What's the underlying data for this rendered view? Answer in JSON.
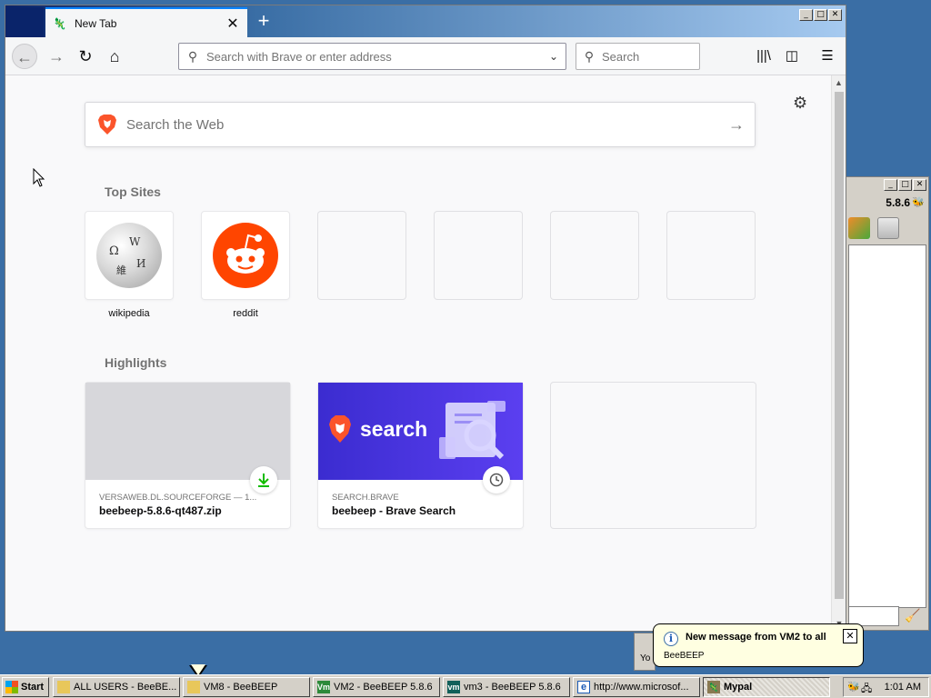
{
  "browser": {
    "tab_title": "New Tab",
    "new_tab_symbol": "+",
    "url_placeholder": "Search with Brave or enter address",
    "search_placeholder": "Search"
  },
  "newtab": {
    "web_search_placeholder": "Search the Web",
    "top_sites_title": "Top Sites",
    "top_sites": [
      {
        "label": "wikipedia",
        "icon": "wikipedia-globe"
      },
      {
        "label": "reddit",
        "icon": "reddit-alien"
      },
      {
        "label": "",
        "icon": ""
      },
      {
        "label": "",
        "icon": ""
      },
      {
        "label": "",
        "icon": ""
      },
      {
        "label": "",
        "icon": ""
      }
    ],
    "highlights_title": "Highlights",
    "highlights": [
      {
        "source": "VERSAWEB.DL.SOURCEFORGE — 1...",
        "title": "beebeep-5.8.6-qt487.zip",
        "badge_icon": "download-icon"
      },
      {
        "source": "SEARCH.BRAVE",
        "title": "beebeep - Brave Search",
        "badge_icon": "clock-icon",
        "thumb_text": "search"
      }
    ]
  },
  "beebeep": {
    "version": "5.8.6"
  },
  "notification": {
    "title": "New message from VM2 to all",
    "body": "BeeBEEP",
    "peek_text": "Yo"
  },
  "taskbar": {
    "start_label": "Start",
    "items": [
      {
        "label": "ALL USERS - BeeBE...",
        "icon": "folder-icon"
      },
      {
        "label": "VM8 - BeeBEEP",
        "icon": "folder-icon"
      },
      {
        "label": "VM2 - BeeBEEP 5.8.6",
        "icon": "vm-icon"
      },
      {
        "label": "vm3 - BeeBEEP 5.8.6",
        "icon": "vm-icon"
      },
      {
        "label": "http://www.microsof...",
        "icon": "ie-icon"
      },
      {
        "label": "Mypal",
        "icon": "mypal-icon",
        "active": true
      }
    ],
    "clock": "1:01 AM"
  },
  "colors": {
    "desktop": "#3a6ea5",
    "brave_orange": "#fb542b",
    "reddit_orange": "#ff4500",
    "download_green": "#12bc00"
  }
}
